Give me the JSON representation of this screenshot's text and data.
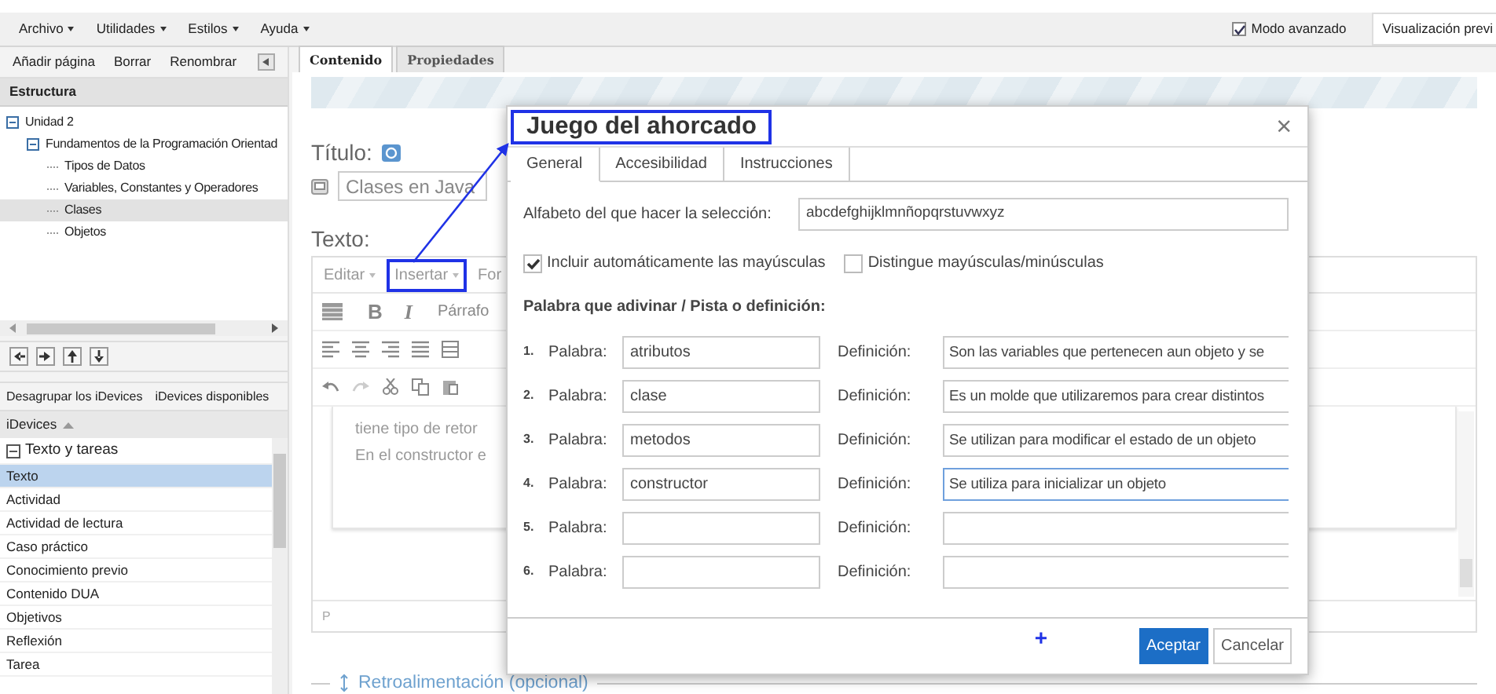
{
  "menubar": {
    "items": [
      "Archivo",
      "Utilidades",
      "Estilos",
      "Ayuda"
    ],
    "advanced_mode": {
      "label": "Modo avanzado",
      "checked": true
    },
    "preview_button": "Visualización previ"
  },
  "sidebar": {
    "toolbar": [
      "Añadir página",
      "Borrar",
      "Renombrar"
    ],
    "structure_title": "Estructura",
    "tree": [
      {
        "label": "Unidad 2",
        "expanded": true,
        "selected": false,
        "children": [
          {
            "label": "Fundamentos de la Programación Orientad",
            "expanded": true,
            "selected": false,
            "children": [
              {
                "label": "Tipos de Datos",
                "selected": false
              },
              {
                "label": "Variables, Constantes y Operadores",
                "selected": false
              },
              {
                "label": "Clases",
                "selected": true
              },
              {
                "label": "Objetos",
                "selected": false
              }
            ]
          }
        ]
      }
    ],
    "idevice_tabs": [
      "Desagrupar los iDevices",
      "iDevices disponibles"
    ],
    "idevices_header": "iDevices",
    "idevice_group": {
      "label": "Texto y tareas",
      "expanded": true,
      "items": [
        {
          "label": "Texto",
          "selected": true
        },
        {
          "label": "Actividad",
          "selected": false
        },
        {
          "label": "Actividad de lectura",
          "selected": false
        },
        {
          "label": "Caso práctico",
          "selected": false
        },
        {
          "label": "Conocimiento previo",
          "selected": false
        },
        {
          "label": "Contenido DUA",
          "selected": false
        },
        {
          "label": "Objetivos",
          "selected": false
        },
        {
          "label": "Reflexión",
          "selected": false
        },
        {
          "label": "Tarea",
          "selected": false
        }
      ]
    }
  },
  "main": {
    "tabs": [
      {
        "label": "Contenido",
        "selected": true
      },
      {
        "label": "Propiedades",
        "selected": false
      }
    ],
    "title_label": "Título:",
    "title_value": "Clases en Java",
    "text_label": "Texto:",
    "editor": {
      "menus": [
        {
          "label": "Editar"
        },
        {
          "label": "Insertar",
          "highlighted": true
        },
        {
          "label": "For"
        }
      ],
      "bold": "B",
      "italic": "I",
      "format": "Párrafo",
      "content": [
        "tiene tipo de retor",
        "En el constructor e"
      ],
      "status": "P"
    },
    "feedback": "Retroalimentación (opcional)"
  },
  "dialog": {
    "title": "Juego del ahorcado",
    "title_highlighted": true,
    "close": "×",
    "tabs": [
      {
        "label": "General",
        "selected": true
      },
      {
        "label": "Accesibilidad",
        "selected": false
      },
      {
        "label": "Instrucciones",
        "selected": false
      }
    ],
    "alphabet_label": "Alfabeto del que hacer la selección:",
    "alphabet_value": "abcdefghijklmnñopqrstuvwxyz",
    "options": [
      {
        "label": "Incluir automáticamente las mayúsculas",
        "checked": true
      },
      {
        "label": "Distingue mayúsculas/minúsculas",
        "checked": false
      }
    ],
    "words_heading": "Palabra que adivinar / Pista o definición:",
    "rows": [
      {
        "number": "1.",
        "word_label": "Palabra:",
        "word": "atributos",
        "definition_label": "Definición:",
        "definition": "Son las variables que pertenecen aun objeto y se",
        "focused": false
      },
      {
        "number": "2.",
        "word_label": "Palabra:",
        "word": "clase",
        "definition_label": "Definición:",
        "definition": "Es un molde que utilizaremos para crear distintos",
        "focused": false
      },
      {
        "number": "3.",
        "word_label": "Palabra:",
        "word": "metodos",
        "definition_label": "Definición:",
        "definition": "Se utilizan para modificar el estado de un objeto",
        "focused": false
      },
      {
        "number": "4.",
        "word_label": "Palabra:",
        "word": "constructor",
        "definition_label": "Definición:",
        "definition": "Se utiliza para inicializar un objeto",
        "focused": true
      },
      {
        "number": "5.",
        "word_label": "Palabra:",
        "definition_label": "Definición:",
        "focused": false
      },
      {
        "number": "6.",
        "word_label": "Palabra:",
        "definition_label": "Definición:",
        "focused": false
      }
    ],
    "add": "+",
    "buttons": [
      {
        "label": "Aceptar",
        "kind": "primary"
      },
      {
        "label": "Cancelar",
        "kind": "secondary"
      }
    ]
  }
}
